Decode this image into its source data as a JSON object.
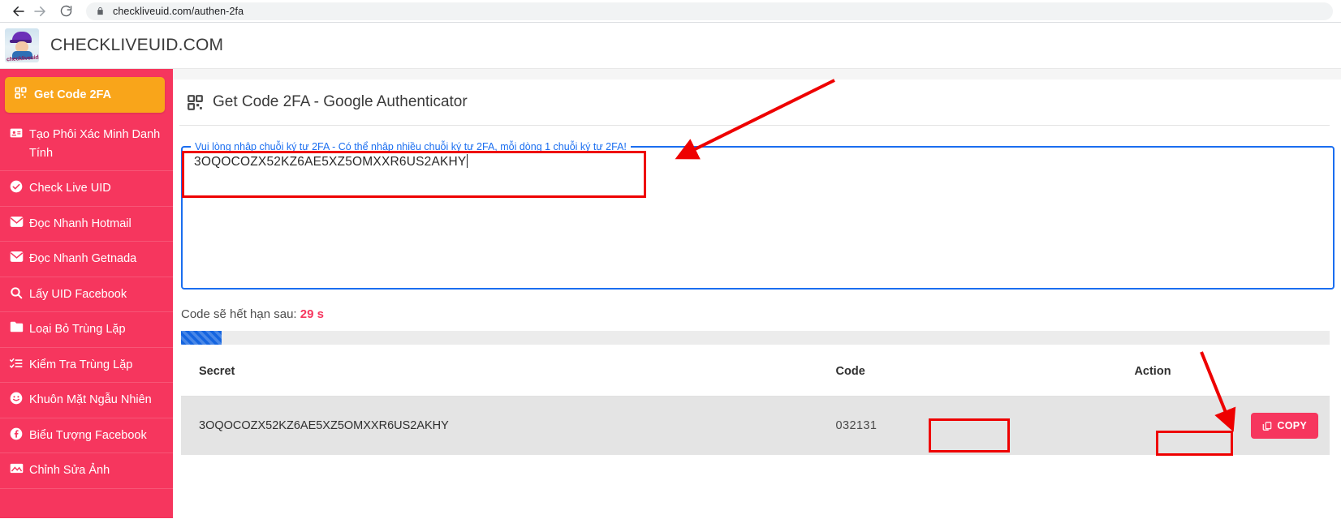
{
  "browser": {
    "back_icon": "arrow-left-icon",
    "forward_icon": "arrow-right-icon",
    "reload_icon": "reload-icon",
    "lock_icon": "lock-icon",
    "url": "checkliveuid.com/authen-2fa"
  },
  "header": {
    "logo_alt": "checkliveuid",
    "logo_word": "checkliveuid",
    "site_title": "CHECKLIVEUID.COM"
  },
  "sidebar": {
    "accent_color": "#f6365e",
    "active_color": "#f9a51a",
    "items": [
      {
        "label": "Get Code 2FA",
        "icon": "qr-code-icon",
        "active": true
      },
      {
        "label": "Tạo Phôi Xác Minh Danh Tính",
        "icon": "id-card-icon",
        "active": false
      },
      {
        "label": "Check Live UID",
        "icon": "check-circle-icon",
        "active": false
      },
      {
        "label": "Đọc Nhanh Hotmail",
        "icon": "envelope-icon",
        "active": false
      },
      {
        "label": "Đọc Nhanh Getnada",
        "icon": "envelope-icon",
        "active": false
      },
      {
        "label": "Lấy UID Facebook",
        "icon": "search-icon",
        "active": false
      },
      {
        "label": "Loại Bỏ Trùng Lặp",
        "icon": "folder-icon",
        "active": false
      },
      {
        "label": "Kiểm Tra Trùng Lặp",
        "icon": "list-check-icon",
        "active": false
      },
      {
        "label": "Khuôn Mặt Ngẫu Nhiên",
        "icon": "smiley-icon",
        "active": false
      },
      {
        "label": "Biểu Tượng Facebook",
        "icon": "facebook-icon",
        "active": false
      },
      {
        "label": "Chỉnh Sửa Ảnh",
        "icon": "image-edit-icon",
        "active": false
      }
    ]
  },
  "main": {
    "card_title": "Get Code 2FA - Google Authenticator",
    "card_icon": "qr-code-icon",
    "input": {
      "legend": "Vui lòng nhập chuỗi ký tự 2FA - Có thể nhập nhiều chuỗi ký tự 2FA, mỗi dòng 1 chuỗi ký tự 2FA!",
      "value": "3OQOCOZX52KZ6AE5XZ5OMXXR6US2AKHY",
      "border_color": "#1a6ef0"
    },
    "expire": {
      "label": "Code sẽ hết hạn sau:",
      "seconds": "29 s",
      "seconds_color": "#f6365e"
    },
    "progress": {
      "percent": 3.55,
      "bar_color": "#1565e0",
      "track_color": "#ececec"
    },
    "table": {
      "columns": [
        "Secret",
        "Code",
        "Action"
      ],
      "rows": [
        {
          "secret": "3OQOCOZX52KZ6AE5XZ5OMXXR6US2AKHY",
          "code": "032131",
          "action_label": "COPY",
          "action_icon": "copy-icon"
        }
      ]
    }
  },
  "annotations": {
    "color": "#ee0000",
    "boxes": [
      "input-field",
      "code-cell",
      "copy-button"
    ],
    "arrows": [
      "arrow-to-input",
      "arrow-to-copy"
    ]
  }
}
